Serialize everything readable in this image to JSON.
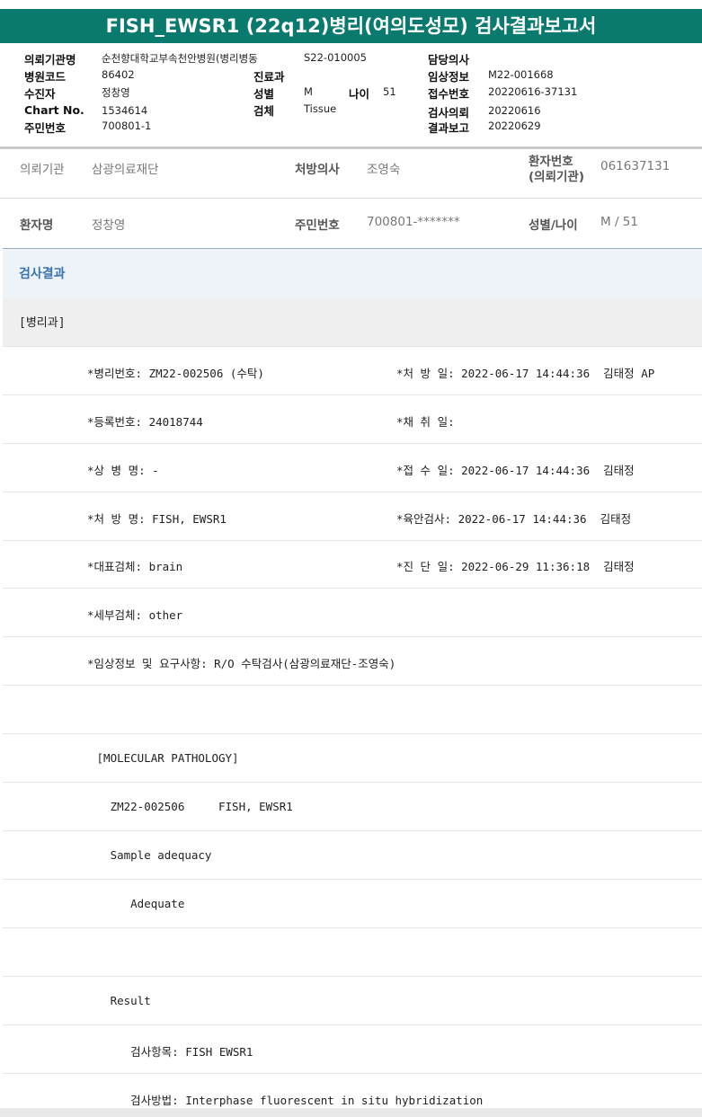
{
  "title": "FISH_EWSR1 (22q12)병리(여의도성모) 검사결과보고서",
  "header": {
    "org_label": "의뢰기관명",
    "org_value": "순천향대학교부속천안병원(병리병동",
    "hospital_code_label": "병원코드",
    "hospital_code_value": "86402",
    "recipient_label": "수진자",
    "recipient_value": "정창영",
    "chart_label": "Chart No.",
    "chart_value": "1534614",
    "resident_label": "주민번호",
    "resident_value": "700801-1",
    "ward_value": "S22-010005",
    "dept_label": "진료과",
    "sex_label": "성별",
    "sex_value": "M",
    "age_label": "나이",
    "age_value": "51",
    "specimen_label": "검체",
    "specimen_value": "Tissue",
    "doctor_label": "담당의사",
    "clinical_label": "임상정보",
    "clinical_value": "M22-001668",
    "receipt_label": "접수번호",
    "receipt_value": "20220616-37131",
    "request_label": "검사의뢰",
    "request_value": "20220616",
    "report_label": "결과보고",
    "report_value": "20220629"
  },
  "info": {
    "agency_label": "의뢰기관",
    "agency_value": "삼광의료재단",
    "prescriber_label": "처방의사",
    "prescriber_value": "조영숙",
    "patient_no_label_1": "환자번호",
    "patient_no_label_2": "(의뢰기관)",
    "patient_no_value": "061637131",
    "patient_name_label": "환자명",
    "patient_name_value": "정창영",
    "resident_label": "주민번호",
    "resident_value": "700801-*******",
    "sex_age_label": "성별/나이",
    "sex_age_value": "M / 51"
  },
  "results": {
    "section_title": "검사결과",
    "dept_tag": "[병리과]",
    "rows": [
      {
        "left": "*병리번호: ZM22-002506 (수탁)",
        "right": "*처 방 일: 2022-06-17 14:44:36  김태정 AP"
      },
      {
        "left": "*등록번호: 24018744",
        "right": "*채 취 일:"
      },
      {
        "left": "*상 병 명: -",
        "right": "*접 수 일: 2022-06-17 14:44:36  김태정"
      },
      {
        "left": "*처 방 명: FISH, EWSR1",
        "right": "*육안검사: 2022-06-17 14:44:36  김태정"
      },
      {
        "left": "*대표검체: brain",
        "right": "*진 단 일: 2022-06-29 11:36:18  김태정"
      },
      {
        "left": "*세부검체: other",
        "right": ""
      },
      {
        "left": "*임상정보 및 요구사항: R/O 수탁검사(삼광의료재단-조영숙)",
        "right": ""
      }
    ],
    "report_lines": [
      "",
      " [MOLECULAR PATHOLOGY]",
      "   ZM22-002506     FISH, EWSR1",
      "   Sample adequacy",
      "      Adequate",
      "",
      "   Result",
      "      검사항목: FISH EWSR1",
      "      검사방법: Interphase fluorescent in situ hybridization"
    ]
  }
}
